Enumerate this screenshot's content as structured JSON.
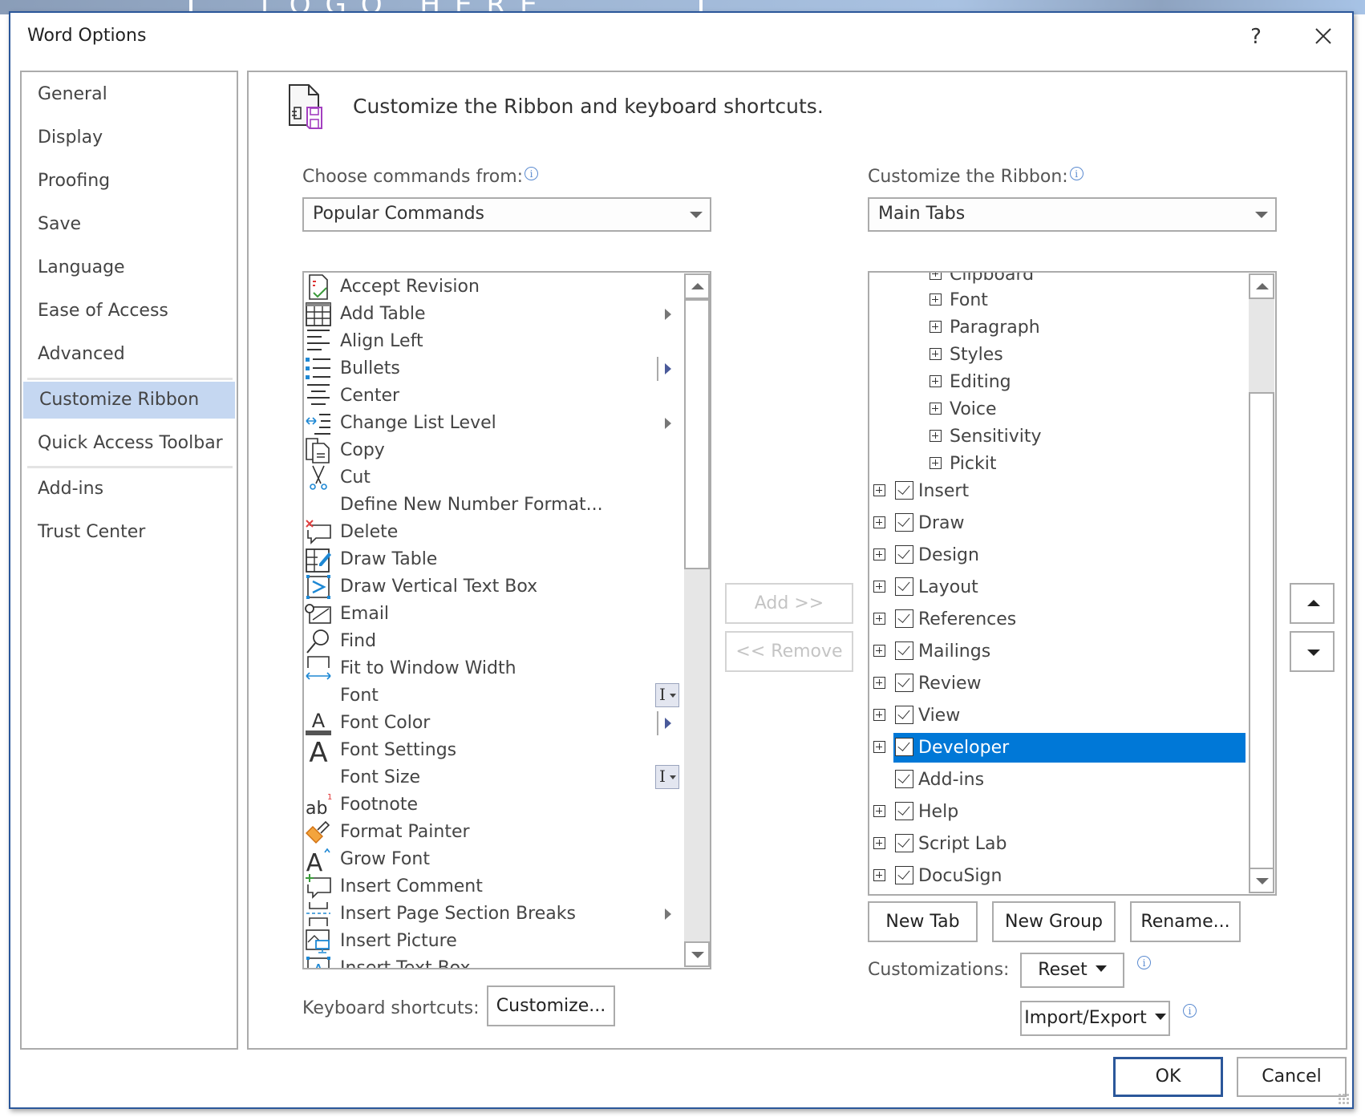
{
  "background": {
    "logo_text": "LOGO HERE"
  },
  "dialog": {
    "title": "Word Options",
    "help_label": "?",
    "close_icon": "close-icon"
  },
  "nav": {
    "items": [
      {
        "label": "General"
      },
      {
        "label": "Display"
      },
      {
        "label": "Proofing"
      },
      {
        "label": "Save"
      },
      {
        "label": "Language"
      },
      {
        "label": "Ease of Access"
      },
      {
        "label": "Advanced"
      },
      {
        "label": "Customize Ribbon",
        "selected": true
      },
      {
        "label": "Quick Access Toolbar"
      },
      {
        "label": "Add-ins"
      },
      {
        "label": "Trust Center"
      }
    ]
  },
  "main": {
    "heading": "Customize the Ribbon and keyboard shortcuts.",
    "header_icon": "customize-ribbon-icon",
    "commands": {
      "label": "Choose commands from:",
      "selected": "Popular Commands",
      "items": [
        {
          "label": "Accept Revision",
          "icon": "accept-revision-icon"
        },
        {
          "label": "Add Table",
          "icon": "table-icon",
          "submenu": true
        },
        {
          "label": "Align Left",
          "icon": "align-left-icon"
        },
        {
          "label": "Bullets",
          "icon": "bullets-icon",
          "split": true
        },
        {
          "label": "Center",
          "icon": "align-center-icon"
        },
        {
          "label": "Change List Level",
          "icon": "list-level-icon",
          "submenu": true
        },
        {
          "label": "Copy",
          "icon": "copy-icon"
        },
        {
          "label": "Cut",
          "icon": "scissors-icon"
        },
        {
          "label": "Define New Number Format...",
          "icon": ""
        },
        {
          "label": "Delete",
          "icon": "delete-comment-icon"
        },
        {
          "label": "Draw Table",
          "icon": "draw-table-icon"
        },
        {
          "label": "Draw Vertical Text Box",
          "icon": "vertical-text-box-icon"
        },
        {
          "label": "Email",
          "icon": "email-icon"
        },
        {
          "label": "Find",
          "icon": "magnifier-icon"
        },
        {
          "label": "Fit to Window Width",
          "icon": "fit-width-icon"
        },
        {
          "label": "Font",
          "icon": "",
          "fontbox": true
        },
        {
          "label": "Font Color",
          "icon": "font-color-icon",
          "split": true
        },
        {
          "label": "Font Settings",
          "icon": "font-settings-icon"
        },
        {
          "label": "Font Size",
          "icon": "",
          "fontbox": true
        },
        {
          "label": "Footnote",
          "icon": "footnote-icon"
        },
        {
          "label": "Format Painter",
          "icon": "paintbrush-icon"
        },
        {
          "label": "Grow Font",
          "icon": "grow-font-icon"
        },
        {
          "label": "Insert Comment",
          "icon": "insert-comment-icon"
        },
        {
          "label": "Insert Page  Section Breaks",
          "icon": "page-break-icon",
          "submenu": true
        },
        {
          "label": "Insert Picture",
          "icon": "insert-picture-icon"
        },
        {
          "label": "Insert Text Box",
          "icon": "text-box-icon"
        }
      ]
    },
    "add_button": "Add >>",
    "remove_button": "<< Remove",
    "ribbon": {
      "label": "Customize the Ribbon:",
      "selected": "Main Tabs",
      "tree": [
        {
          "label": "Clipboard",
          "level": 2,
          "expander": true,
          "checkbox": false
        },
        {
          "label": "Font",
          "level": 2,
          "expander": true,
          "checkbox": false
        },
        {
          "label": "Paragraph",
          "level": 2,
          "expander": true,
          "checkbox": false
        },
        {
          "label": "Styles",
          "level": 2,
          "expander": true,
          "checkbox": false
        },
        {
          "label": "Editing",
          "level": 2,
          "expander": true,
          "checkbox": false
        },
        {
          "label": "Voice",
          "level": 2,
          "expander": true,
          "checkbox": false
        },
        {
          "label": "Sensitivity",
          "level": 2,
          "expander": true,
          "checkbox": false
        },
        {
          "label": "Pickit",
          "level": 2,
          "expander": true,
          "checkbox": false
        },
        {
          "label": "Insert",
          "level": 1,
          "expander": true,
          "checkbox": true,
          "checked": true
        },
        {
          "label": "Draw",
          "level": 1,
          "expander": true,
          "checkbox": true,
          "checked": true
        },
        {
          "label": "Design",
          "level": 1,
          "expander": true,
          "checkbox": true,
          "checked": true
        },
        {
          "label": "Layout",
          "level": 1,
          "expander": true,
          "checkbox": true,
          "checked": true
        },
        {
          "label": "References",
          "level": 1,
          "expander": true,
          "checkbox": true,
          "checked": true
        },
        {
          "label": "Mailings",
          "level": 1,
          "expander": true,
          "checkbox": true,
          "checked": true
        },
        {
          "label": "Review",
          "level": 1,
          "expander": true,
          "checkbox": true,
          "checked": true
        },
        {
          "label": "View",
          "level": 1,
          "expander": true,
          "checkbox": true,
          "checked": true
        },
        {
          "label": "Developer",
          "level": 1,
          "expander": true,
          "checkbox": true,
          "checked": true,
          "selected": true
        },
        {
          "label": "Add-ins",
          "level": 1,
          "expander": false,
          "checkbox": true,
          "checked": true
        },
        {
          "label": "Help",
          "level": 1,
          "expander": true,
          "checkbox": true,
          "checked": true
        },
        {
          "label": "Script Lab",
          "level": 1,
          "expander": true,
          "checkbox": true,
          "checked": true
        },
        {
          "label": "DocuSign",
          "level": 1,
          "expander": true,
          "checkbox": true,
          "checked": true
        }
      ]
    },
    "move_up_icon": "move-up-icon",
    "move_down_icon": "move-down-icon",
    "new_tab_button": "New Tab",
    "new_group_button": "New Group",
    "rename_button": "Rename...",
    "customizations_label": "Customizations:",
    "reset_button": "Reset",
    "import_export_button": "Import/Export",
    "keyboard_label": "Keyboard shortcuts:",
    "customize_button": "Customize..."
  },
  "footer": {
    "ok_button": "OK",
    "cancel_button": "Cancel"
  },
  "colors": {
    "dialog_border": "#2b579a",
    "nav_selected": "#c5d7f1",
    "tree_selected": "#0078d7"
  }
}
